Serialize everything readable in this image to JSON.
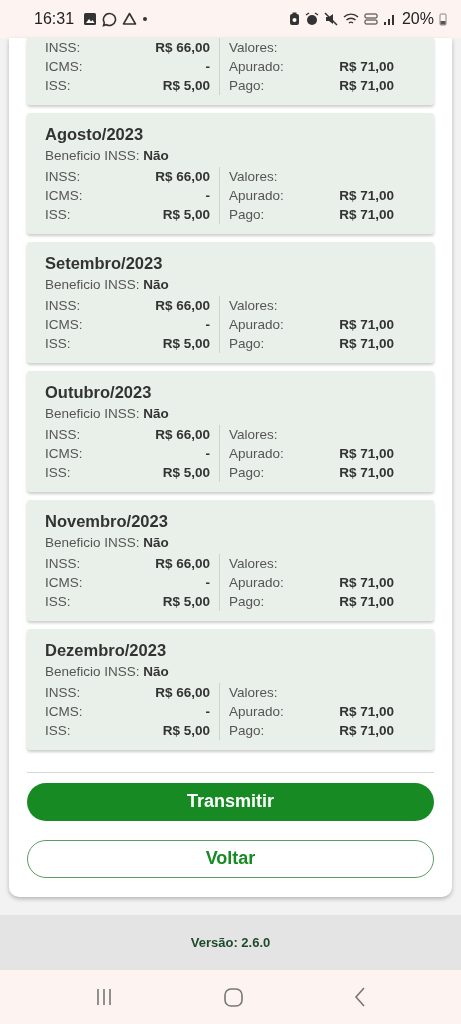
{
  "status_bar": {
    "time": "16:31",
    "battery": "20%"
  },
  "cards": [
    {
      "rows": [
        {
          "label": "INSS:",
          "value": "R$ 66,00",
          "r_label": "Valores:",
          "r_value": ""
        },
        {
          "label": "ICMS:",
          "value": "-",
          "r_label": "Apurado:",
          "r_value": "R$ 71,00"
        },
        {
          "label": "ISS:",
          "value": "R$ 5,00",
          "r_label": "Pago:",
          "r_value": "R$ 71,00"
        }
      ]
    },
    {
      "title": "Agosto/2023",
      "benefit_label": "Beneficio INSS:",
      "benefit_value": "Não",
      "rows": [
        {
          "label": "INSS:",
          "value": "R$ 66,00",
          "r_label": "Valores:",
          "r_value": ""
        },
        {
          "label": "ICMS:",
          "value": "-",
          "r_label": "Apurado:",
          "r_value": "R$ 71,00"
        },
        {
          "label": "ISS:",
          "value": "R$ 5,00",
          "r_label": "Pago:",
          "r_value": "R$ 71,00"
        }
      ]
    },
    {
      "title": "Setembro/2023",
      "benefit_label": "Beneficio INSS:",
      "benefit_value": "Não",
      "rows": [
        {
          "label": "INSS:",
          "value": "R$ 66,00",
          "r_label": "Valores:",
          "r_value": ""
        },
        {
          "label": "ICMS:",
          "value": "-",
          "r_label": "Apurado:",
          "r_value": "R$ 71,00"
        },
        {
          "label": "ISS:",
          "value": "R$ 5,00",
          "r_label": "Pago:",
          "r_value": "R$ 71,00"
        }
      ]
    },
    {
      "title": "Outubro/2023",
      "benefit_label": "Beneficio INSS:",
      "benefit_value": "Não",
      "rows": [
        {
          "label": "INSS:",
          "value": "R$ 66,00",
          "r_label": "Valores:",
          "r_value": ""
        },
        {
          "label": "ICMS:",
          "value": "-",
          "r_label": "Apurado:",
          "r_value": "R$ 71,00"
        },
        {
          "label": "ISS:",
          "value": "R$ 5,00",
          "r_label": "Pago:",
          "r_value": "R$ 71,00"
        }
      ]
    },
    {
      "title": "Novembro/2023",
      "benefit_label": "Beneficio INSS:",
      "benefit_value": "Não",
      "rows": [
        {
          "label": "INSS:",
          "value": "R$ 66,00",
          "r_label": "Valores:",
          "r_value": ""
        },
        {
          "label": "ICMS:",
          "value": "-",
          "r_label": "Apurado:",
          "r_value": "R$ 71,00"
        },
        {
          "label": "ISS:",
          "value": "R$ 5,00",
          "r_label": "Pago:",
          "r_value": "R$ 71,00"
        }
      ]
    },
    {
      "title": "Dezembro/2023",
      "benefit_label": "Beneficio INSS:",
      "benefit_value": "Não",
      "rows": [
        {
          "label": "INSS:",
          "value": "R$ 66,00",
          "r_label": "Valores:",
          "r_value": ""
        },
        {
          "label": "ICMS:",
          "value": "-",
          "r_label": "Apurado:",
          "r_value": "R$ 71,00"
        },
        {
          "label": "ISS:",
          "value": "R$ 5,00",
          "r_label": "Pago:",
          "r_value": "R$ 71,00"
        }
      ]
    }
  ],
  "buttons": [
    {
      "label": "Transmitir",
      "kind": "primary"
    },
    {
      "label": "Voltar",
      "kind": "outline"
    }
  ],
  "footer": {
    "version": "Versão: 2.6.0"
  }
}
